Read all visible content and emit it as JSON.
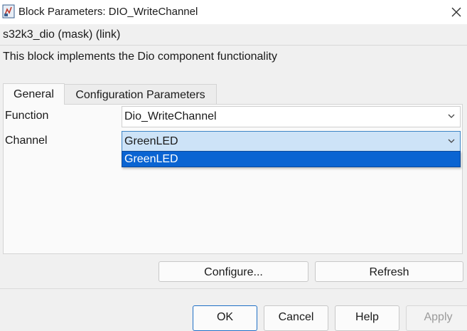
{
  "window": {
    "title": "Block Parameters: DIO_WriteChannel",
    "app_icon": "simulink-block-icon",
    "close_icon": "close-icon"
  },
  "header": {
    "mask_info": "s32k3_dio (mask) (link)",
    "description": "This block implements the Dio component functionality"
  },
  "tabs": [
    {
      "label": "General",
      "active": true
    },
    {
      "label": "Configuration Parameters",
      "active": false
    }
  ],
  "params": {
    "function": {
      "label": "Function",
      "value": "Dio_WriteChannel"
    },
    "channel": {
      "label": "Channel",
      "value": "GreenLED",
      "options": [
        "GreenLED"
      ]
    }
  },
  "actions": {
    "configure": "Configure...",
    "refresh": "Refresh"
  },
  "footer": {
    "ok": "OK",
    "cancel": "Cancel",
    "help": "Help",
    "apply": "Apply"
  },
  "colors": {
    "selection": "#0a64d2",
    "focused_field": "#cde3f7",
    "background": "#f0f0f0"
  }
}
